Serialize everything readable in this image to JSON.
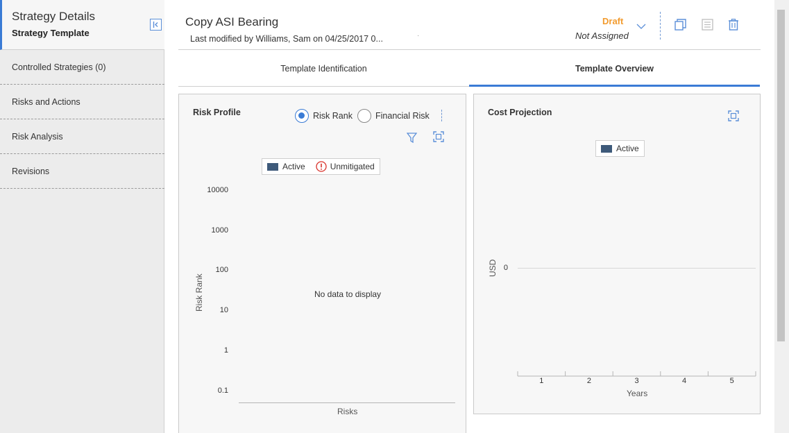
{
  "sidebar": {
    "title": "Strategy Details",
    "subtitle": "Strategy Template",
    "items": [
      {
        "label": "Controlled Strategies (0)"
      },
      {
        "label": "Risks and Actions"
      },
      {
        "label": "Risk Analysis"
      },
      {
        "label": "Revisions"
      }
    ]
  },
  "header": {
    "title": "Copy ASI Bearing",
    "modified": "Last modified by Williams, Sam on 04/25/2017 0...",
    "status": "Draft",
    "assignment": "Not Assigned"
  },
  "tabs": [
    {
      "label": "Template Identification",
      "active": false
    },
    {
      "label": "Template Overview",
      "active": true
    }
  ],
  "risk_profile": {
    "title": "Risk Profile",
    "radio_options": [
      {
        "label": "Risk Rank",
        "selected": true
      },
      {
        "label": "Financial Risk",
        "selected": false
      }
    ],
    "legend": [
      "Active",
      "Unmitigated"
    ],
    "y_ticks": [
      "10000",
      "1000",
      "100",
      "10",
      "1",
      "0.1"
    ],
    "y_label": "Risk Rank",
    "x_label": "Risks",
    "empty_message": "No data to display"
  },
  "cost_projection": {
    "title": "Cost Projection",
    "legend": [
      "Active"
    ],
    "y_label": "USD",
    "y_tick": "0",
    "x_ticks": [
      "1",
      "2",
      "3",
      "4",
      "5"
    ],
    "x_label": "Years"
  },
  "colors": {
    "accent": "#3a7bd5",
    "draft": "#f29b2e",
    "series_active": "#3e5a7a",
    "unmitigated": "#d9322b"
  },
  "chart_data": [
    {
      "type": "scatter",
      "title": "Risk Profile",
      "xlabel": "Risks",
      "ylabel": "Risk Rank",
      "yscale": "log",
      "ylim": [
        0.1,
        10000
      ],
      "y_ticks": [
        10000,
        1000,
        100,
        10,
        1,
        0.1
      ],
      "series": [
        {
          "name": "Active",
          "values": []
        },
        {
          "name": "Unmitigated",
          "values": []
        }
      ],
      "legend": "top-center"
    },
    {
      "type": "bar",
      "title": "Cost Projection",
      "xlabel": "Years",
      "ylabel": "USD",
      "categories": [
        "1",
        "2",
        "3",
        "4",
        "5"
      ],
      "series": [
        {
          "name": "Active",
          "values": [
            0,
            0,
            0,
            0,
            0
          ]
        }
      ],
      "legend": "top-center"
    }
  ]
}
